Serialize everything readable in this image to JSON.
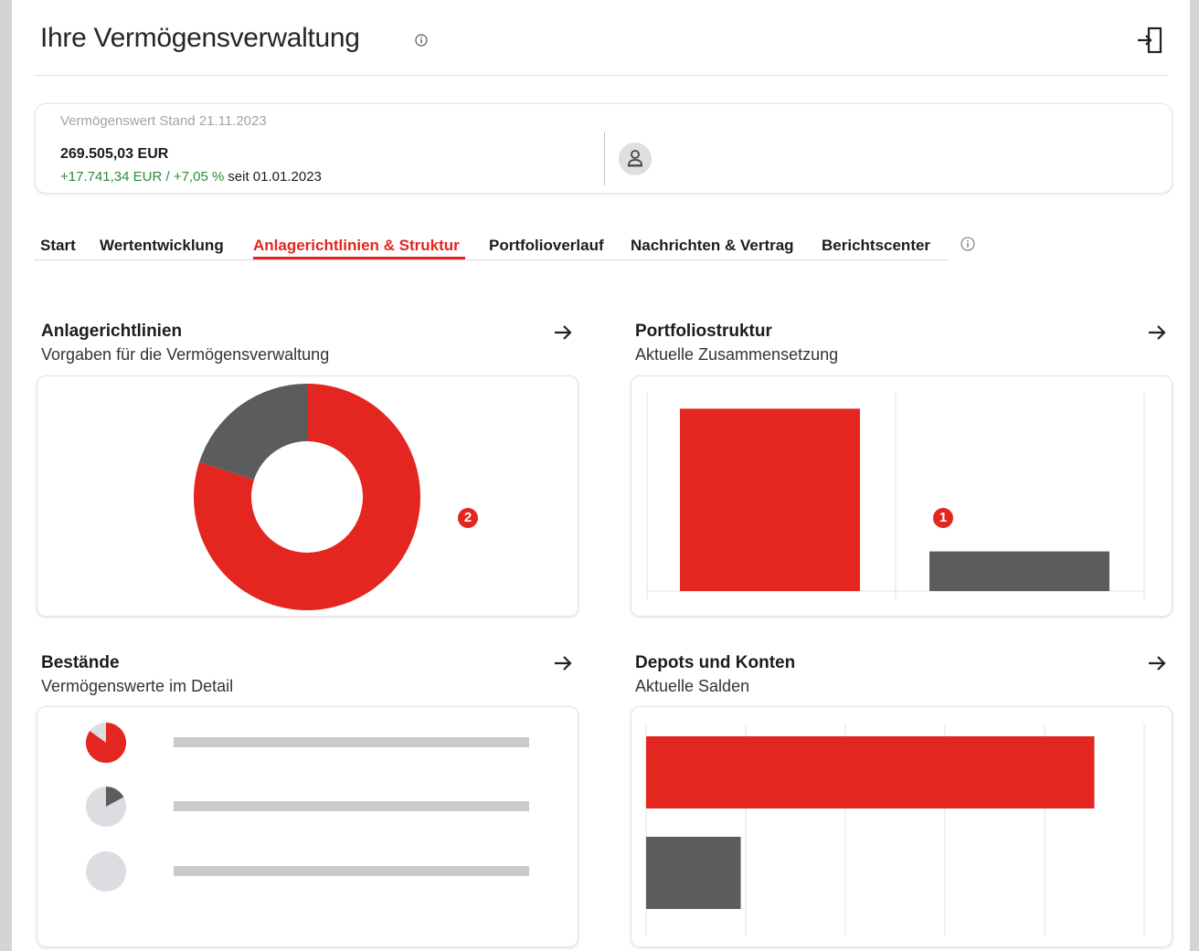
{
  "header": {
    "title": "Ihre Vermögensverwaltung",
    "info_icon": "info-icon",
    "logout_icon": "logout-icon"
  },
  "summary": {
    "label": "Vermögenswert Stand 21.11.2023",
    "value": "269.505,03 EUR",
    "change": "+17.741,34 EUR / +7,05 %",
    "since": "seit 01.01.2023",
    "avatar_icon": "person-icon",
    "colors": {
      "positive": "#2e8b3a"
    }
  },
  "tabs": [
    {
      "label": "Start",
      "active": false
    },
    {
      "label": "Wertentwicklung",
      "active": false
    },
    {
      "label": "Anlagerichtlinien & Struktur",
      "active": true
    },
    {
      "label": "Portfolioverlauf",
      "active": false
    },
    {
      "label": "Nachrichten & Vertrag",
      "active": false
    },
    {
      "label": "Berichtscenter",
      "active": false
    }
  ],
  "colors": {
    "accent": "#e3261f",
    "dark": "#5a5c5e",
    "placeholder": "#c9cacc"
  },
  "cards": {
    "anlagerichtlinien": {
      "title": "Anlagerichtlinien",
      "subtitle": "Vorgaben für die Vermögensverwaltung",
      "marker": "2"
    },
    "portfoliostruktur": {
      "title": "Portfoliostruktur",
      "subtitle": "Aktuelle Zusammensetzung",
      "marker": "1"
    },
    "bestaende": {
      "title": "Bestände",
      "subtitle": "Vermögenswerte im Detail"
    },
    "depots": {
      "title": "Depots und Konten",
      "subtitle": "Aktuelle Salden"
    }
  },
  "chart_data": [
    {
      "type": "pie",
      "values": [
        0.8,
        0.2
      ],
      "colors": [
        "#e3261f",
        "#5a5c5e"
      ],
      "donut": true
    },
    {
      "type": "bar",
      "values": [
        0.92,
        0.2
      ],
      "colors": [
        "#e3261f",
        "#5a5c5e"
      ],
      "grid": true
    },
    {
      "type": "bar",
      "orientation": "horizontal",
      "values": [
        0.9,
        0.19
      ],
      "colors": [
        "#e3261f",
        "#5a5c5e"
      ],
      "grid": true
    },
    {
      "type": "pie",
      "items": [
        {
          "fraction": 0.85,
          "color": "#e3261f"
        },
        {
          "fraction": 0.17,
          "color": "#5a5c5e"
        },
        {
          "fraction": 0,
          "color": "#5a5c5e"
        }
      ]
    }
  ]
}
